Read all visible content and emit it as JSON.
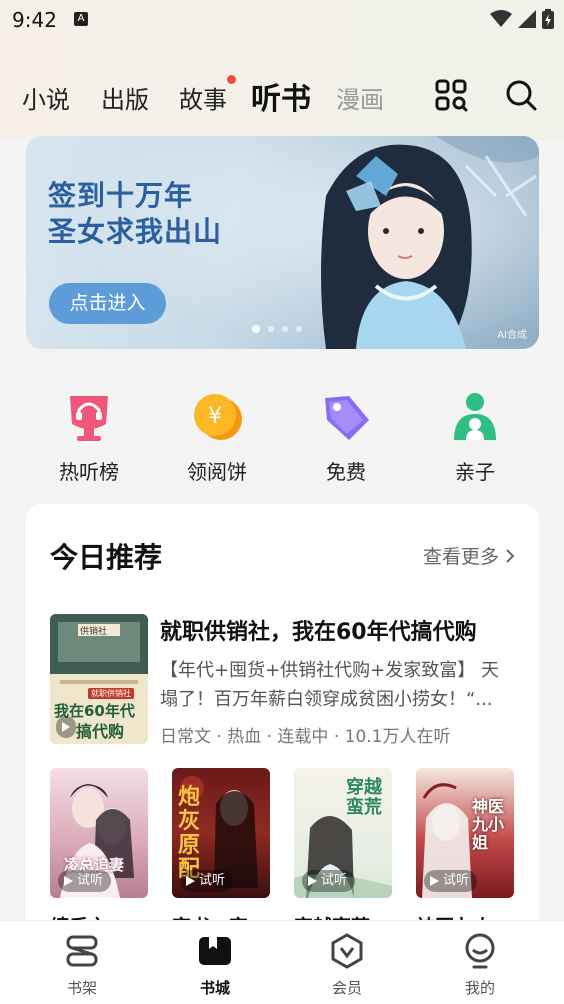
{
  "status_bar": {
    "time": "9:42",
    "notification_glyph": "A"
  },
  "tabs": [
    {
      "label": "小说",
      "active": false
    },
    {
      "label": "出版",
      "active": false
    },
    {
      "label": "故事",
      "active": false,
      "badge": "red-dot"
    },
    {
      "label": "听书",
      "active": true
    },
    {
      "label": "漫画",
      "active": false
    }
  ],
  "header_icons": [
    "scan-grid-icon",
    "search-icon"
  ],
  "banner": {
    "title_line1": "签到十万年",
    "title_line2": "圣女求我出山",
    "button_label": "点击进入",
    "ai_tag": "AI合成",
    "dot_count": 4,
    "active_dot": 0
  },
  "quick_entries": [
    {
      "label": "热听榜",
      "icon": "headphone-trophy-icon",
      "color": "#f0567a"
    },
    {
      "label": "领阅饼",
      "icon": "coin-icon",
      "color": "#f7a21b"
    },
    {
      "label": "免费",
      "icon": "tag-icon",
      "color": "#8a6cf2"
    },
    {
      "label": "亲子",
      "icon": "family-icon",
      "color": "#2fbf84"
    }
  ],
  "recommend": {
    "title": "今日推荐",
    "more_label": "查看更多",
    "featured": {
      "title": "就职供销社，我在60年代搞代购",
      "description": "【年代+囤货+供销社代购+发家致富】 天塌了！百万年薪白领穿成贫困小捞女！“...",
      "meta": "日常文 · 热血 · 连载中 · 10.1万人在听",
      "cover_text_top": "我在60年代",
      "cover_text_bottom": "搞代购",
      "cover_badge": "就职供销社",
      "cover_sign": "供销社"
    },
    "trial_label": "试听",
    "books": [
      {
        "title": "缠后之",
        "cover_text": "凌总追妻",
        "palette": "pink"
      },
      {
        "title": "穿书：穿",
        "cover_text": "炮灰原配",
        "palette": "red"
      },
      {
        "title": "穿越蛮荒",
        "cover_text": "穿越蛮荒",
        "palette": "green"
      },
      {
        "title": "神医九小",
        "cover_text": "神医九小姐",
        "palette": "crimson"
      }
    ]
  },
  "bottom_nav": [
    {
      "label": "书架",
      "icon": "bookshelf-icon",
      "active": false
    },
    {
      "label": "书城",
      "icon": "bookstore-icon",
      "active": true
    },
    {
      "label": "会员",
      "icon": "vip-icon",
      "active": false
    },
    {
      "label": "我的",
      "icon": "profile-icon",
      "active": false
    }
  ],
  "colors": {
    "accent_blue": "#5d9bd9",
    "badge_red": "#f04b3c",
    "text_primary": "#111111"
  }
}
